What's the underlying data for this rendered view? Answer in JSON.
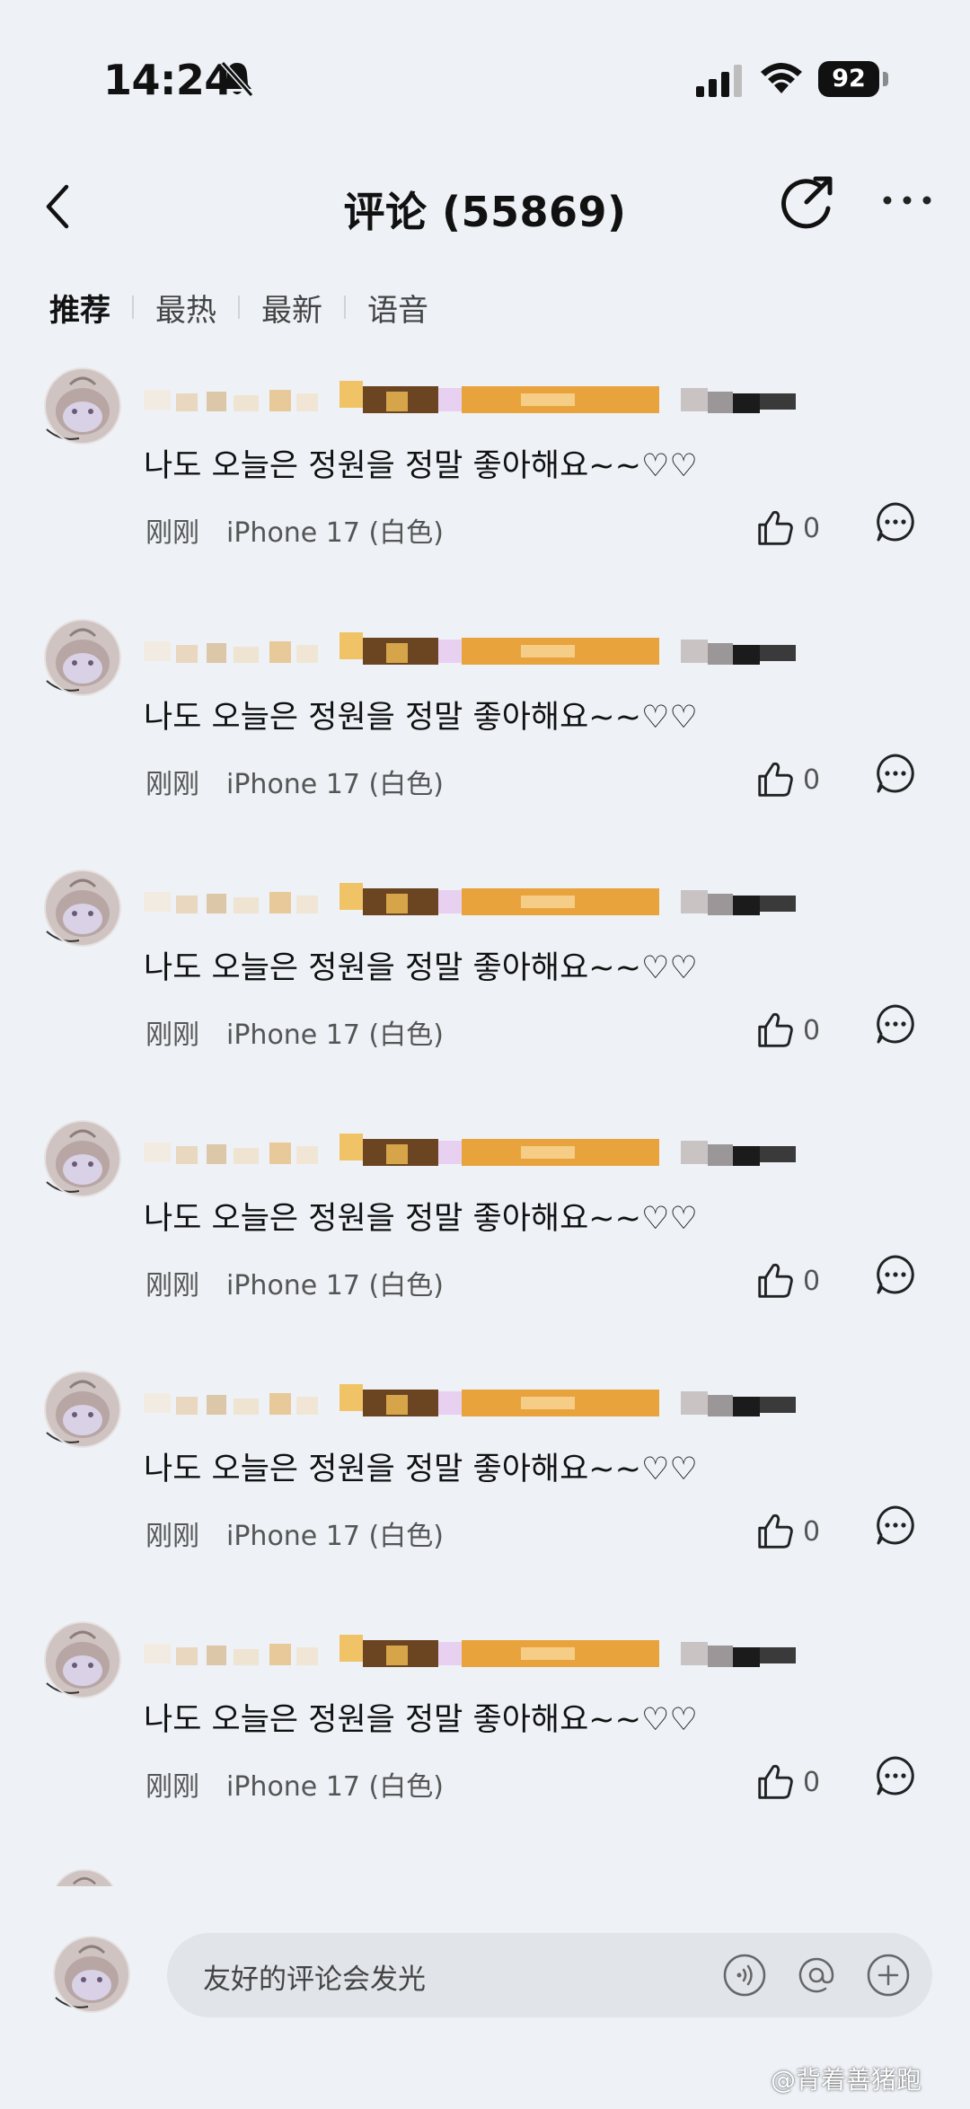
{
  "status_bar": {
    "time": "14:24",
    "battery": "92",
    "icons": [
      "bell-slash-icon",
      "signal-icon",
      "wifi-icon",
      "battery-icon"
    ]
  },
  "nav": {
    "title": "评论 (55869)",
    "icons": [
      "back-chevron-icon",
      "share-icon",
      "more-icon"
    ]
  },
  "tabs": [
    {
      "label": "推荐",
      "active": true
    },
    {
      "label": "最热",
      "active": false
    },
    {
      "label": "最新",
      "active": false
    },
    {
      "label": "语音",
      "active": false
    }
  ],
  "comments": [
    {
      "text": "나도 오늘은 정원을 정말 좋아해요~~♡♡",
      "time": "刚刚",
      "device": "iPhone 17 (白色)",
      "likes": "0"
    },
    {
      "text": "나도 오늘은 정원을 정말 좋아해요~~♡♡",
      "time": "刚刚",
      "device": "iPhone 17 (白色)",
      "likes": "0"
    },
    {
      "text": "나도 오늘은 정원을 정말 좋아해요~~♡♡",
      "time": "刚刚",
      "device": "iPhone 17 (白色)",
      "likes": "0"
    },
    {
      "text": "나도 오늘은 정원을 정말 좋아해요~~♡♡",
      "time": "刚刚",
      "device": "iPhone 17 (白色)",
      "likes": "0"
    },
    {
      "text": "나도 오늘은 정원을 정말 좋아해요~~♡♡",
      "time": "刚刚",
      "device": "iPhone 17 (白色)",
      "likes": "0"
    },
    {
      "text": "나도 오늘은 정원을 정말 좋아해요~~♡♡",
      "time": "刚刚",
      "device": "iPhone 17 (白色)",
      "likes": "0"
    }
  ],
  "composer": {
    "placeholder": "友好的评论会发光",
    "icons": [
      "voice-icon",
      "at-icon",
      "plus-icon"
    ]
  },
  "watermark": "@背着善猪跑",
  "colors": {
    "background": "#eef2f7",
    "text": "#111111",
    "secondary_text": "#555555",
    "input_background": "#e1e5ea",
    "pixelation_orange": "#e8a33d",
    "pixelation_brown": "#5a3a1c"
  }
}
